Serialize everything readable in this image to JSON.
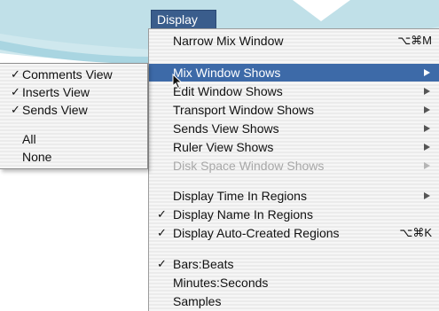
{
  "menubar": {
    "title": "Display"
  },
  "menu": {
    "items": [
      {
        "label": "Narrow Mix Window",
        "shortcut": "⌥⌘M",
        "checked": false
      },
      {
        "label": "Mix Window Shows",
        "submenu": true,
        "highlighted": true
      },
      {
        "label": "Edit Window Shows",
        "submenu": true
      },
      {
        "label": "Transport Window Shows",
        "submenu": true
      },
      {
        "label": "Sends View Shows",
        "submenu": true
      },
      {
        "label": "Ruler View Shows",
        "submenu": true
      },
      {
        "label": "Disk Space Window Shows",
        "submenu": true,
        "disabled": true
      },
      {
        "label": "Display Time In Regions",
        "submenu": true
      },
      {
        "label": "Display Name In Regions",
        "checked": true
      },
      {
        "label": "Display Auto-Created Regions",
        "shortcut": "⌥⌘K",
        "checked": true
      },
      {
        "label": "Bars:Beats",
        "checked": true
      },
      {
        "label": "Minutes:Seconds"
      },
      {
        "label": "Samples"
      }
    ],
    "check_mark": "✓"
  },
  "submenu": {
    "items": [
      {
        "label": "Comments View",
        "checked": true
      },
      {
        "label": "Inserts View",
        "checked": true
      },
      {
        "label": "Sends View",
        "checked": true
      },
      {
        "label": "All"
      },
      {
        "label": "None"
      }
    ]
  },
  "colors": {
    "highlight": "#3d6aa8",
    "menu_title_bg": "#3a5d8c",
    "background_art": "#b7dce6"
  },
  "icons": {
    "submenu_arrow": "triangle-right-icon",
    "cursor": "arrow-cursor-icon"
  }
}
